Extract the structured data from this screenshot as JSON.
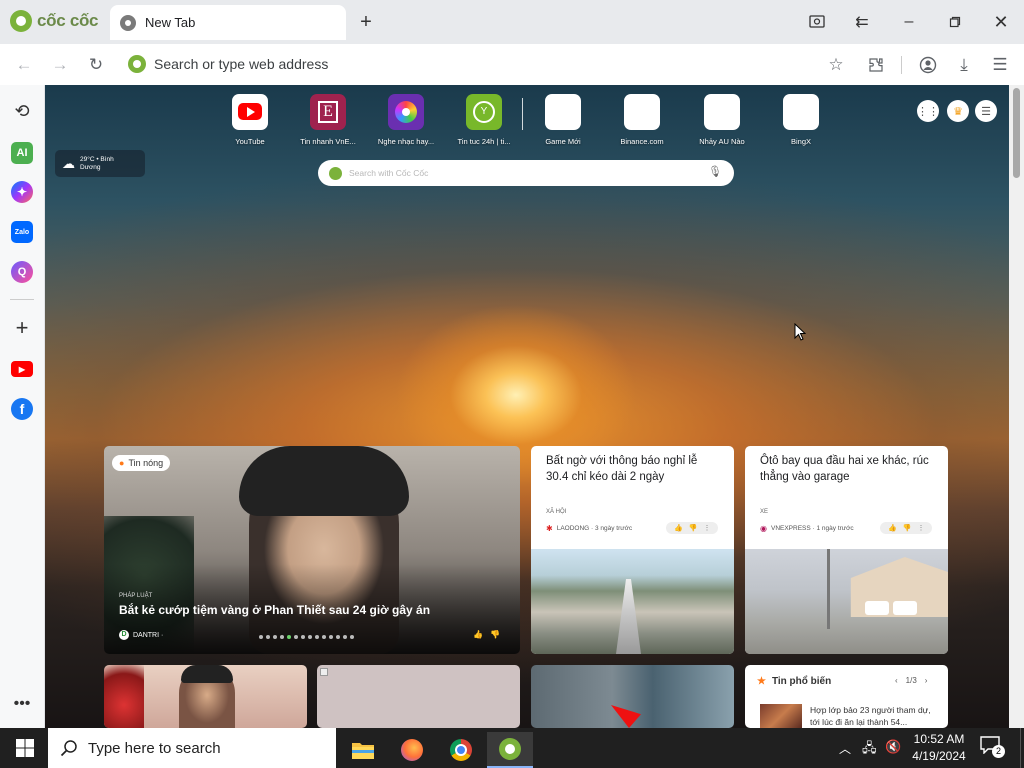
{
  "browser": {
    "brand": "cốc cốc",
    "tab_title": "New Tab",
    "address_placeholder": "Search or type web address"
  },
  "speed_dial": [
    {
      "label": "YouTube",
      "icon": "youtube-icon"
    },
    {
      "label": "Tin nhanh VnE...",
      "icon": "vnexpress-icon"
    },
    {
      "label": "Nghe nhạc hay...",
      "icon": "music-icon"
    },
    {
      "label": "Tin tuc 24h | ti...",
      "icon": "news24h-icon"
    },
    {
      "label": "Game Mới",
      "icon": "blank-tile"
    },
    {
      "label": "Binance.com",
      "icon": "blank-tile"
    },
    {
      "label": "Nhảy AU Nào",
      "icon": "blank-tile"
    },
    {
      "label": "BingX",
      "icon": "blank-tile"
    }
  ],
  "weather": {
    "line1": "29°C • Bình",
    "line2": "Dương"
  },
  "newtab_search": {
    "placeholder": "Search with Cốc Cốc"
  },
  "cards": {
    "hot": {
      "badge": "Tin nóng",
      "category": "PHÁP LUẬT",
      "title": "Bắt kẻ cướp tiệm vàng ở Phan Thiết sau 24 giờ gây án",
      "source": "DANTRI ·"
    },
    "card2": {
      "title": "Bất ngờ với thông báo nghỉ lễ 30.4 chỉ kéo dài 2 ngày",
      "category": "XÃ HỘI",
      "source": "LAODONG · 3 ngày trước"
    },
    "card3": {
      "title": "Ôtô bay qua đầu hai xe khác, rúc thẳng vào garage",
      "category": "XE",
      "source": "VNEXPRESS · 1 ngày trước"
    },
    "popular": {
      "header": "Tin phổ biến",
      "pager": "1/3",
      "item_title": "Hợp lớp bảo 23 người tham dự, tới lúc đi ăn lại thành 54..."
    }
  },
  "taskbar": {
    "search_placeholder": "Type here to search",
    "time": "10:52 AM",
    "date": "4/19/2024",
    "notification_count": "2"
  }
}
